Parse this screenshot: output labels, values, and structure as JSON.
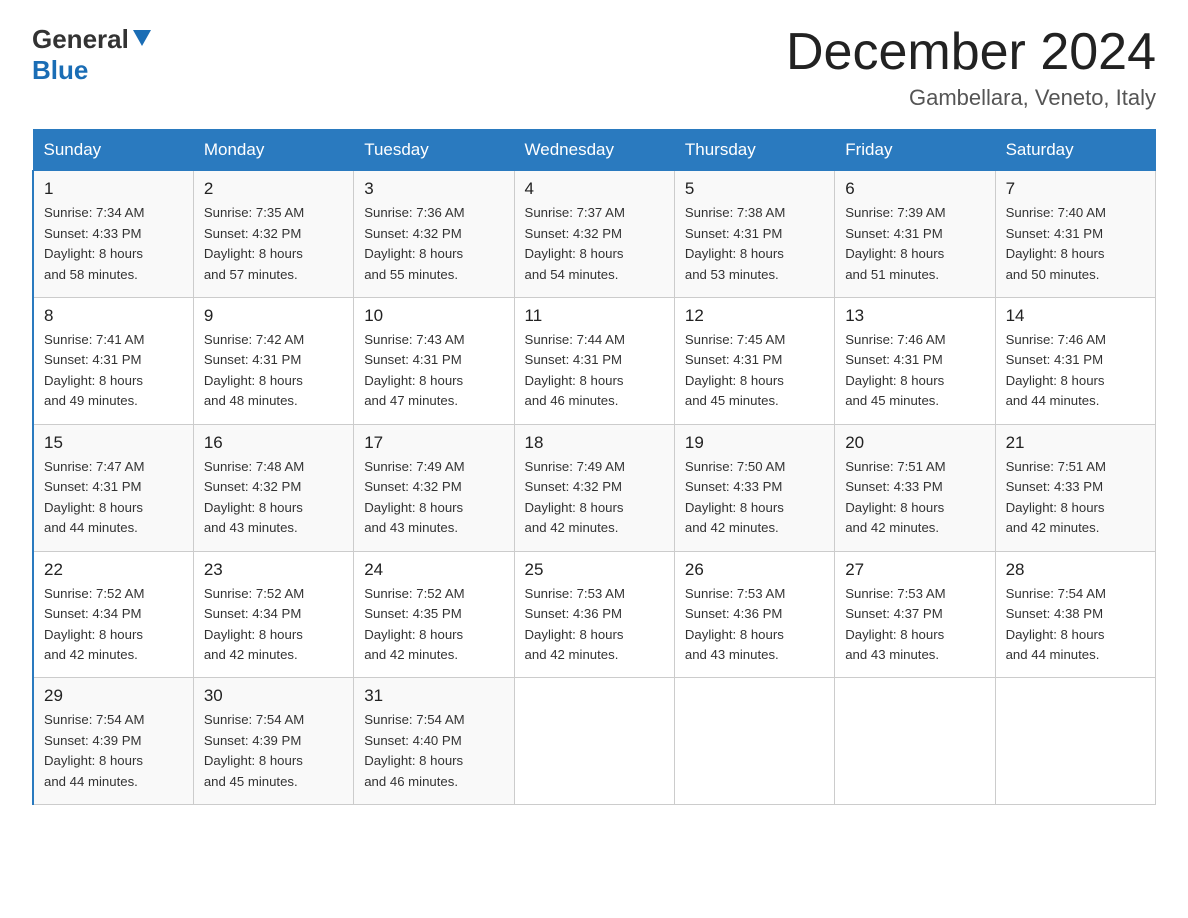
{
  "header": {
    "logo_general": "General",
    "logo_blue": "Blue",
    "month_title": "December 2024",
    "location": "Gambellara, Veneto, Italy"
  },
  "days_of_week": [
    "Sunday",
    "Monday",
    "Tuesday",
    "Wednesday",
    "Thursday",
    "Friday",
    "Saturday"
  ],
  "weeks": [
    [
      {
        "day": "1",
        "sunrise": "7:34 AM",
        "sunset": "4:33 PM",
        "daylight": "8 hours and 58 minutes."
      },
      {
        "day": "2",
        "sunrise": "7:35 AM",
        "sunset": "4:32 PM",
        "daylight": "8 hours and 57 minutes."
      },
      {
        "day": "3",
        "sunrise": "7:36 AM",
        "sunset": "4:32 PM",
        "daylight": "8 hours and 55 minutes."
      },
      {
        "day": "4",
        "sunrise": "7:37 AM",
        "sunset": "4:32 PM",
        "daylight": "8 hours and 54 minutes."
      },
      {
        "day": "5",
        "sunrise": "7:38 AM",
        "sunset": "4:31 PM",
        "daylight": "8 hours and 53 minutes."
      },
      {
        "day": "6",
        "sunrise": "7:39 AM",
        "sunset": "4:31 PM",
        "daylight": "8 hours and 51 minutes."
      },
      {
        "day": "7",
        "sunrise": "7:40 AM",
        "sunset": "4:31 PM",
        "daylight": "8 hours and 50 minutes."
      }
    ],
    [
      {
        "day": "8",
        "sunrise": "7:41 AM",
        "sunset": "4:31 PM",
        "daylight": "8 hours and 49 minutes."
      },
      {
        "day": "9",
        "sunrise": "7:42 AM",
        "sunset": "4:31 PM",
        "daylight": "8 hours and 48 minutes."
      },
      {
        "day": "10",
        "sunrise": "7:43 AM",
        "sunset": "4:31 PM",
        "daylight": "8 hours and 47 minutes."
      },
      {
        "day": "11",
        "sunrise": "7:44 AM",
        "sunset": "4:31 PM",
        "daylight": "8 hours and 46 minutes."
      },
      {
        "day": "12",
        "sunrise": "7:45 AM",
        "sunset": "4:31 PM",
        "daylight": "8 hours and 45 minutes."
      },
      {
        "day": "13",
        "sunrise": "7:46 AM",
        "sunset": "4:31 PM",
        "daylight": "8 hours and 45 minutes."
      },
      {
        "day": "14",
        "sunrise": "7:46 AM",
        "sunset": "4:31 PM",
        "daylight": "8 hours and 44 minutes."
      }
    ],
    [
      {
        "day": "15",
        "sunrise": "7:47 AM",
        "sunset": "4:31 PM",
        "daylight": "8 hours and 44 minutes."
      },
      {
        "day": "16",
        "sunrise": "7:48 AM",
        "sunset": "4:32 PM",
        "daylight": "8 hours and 43 minutes."
      },
      {
        "day": "17",
        "sunrise": "7:49 AM",
        "sunset": "4:32 PM",
        "daylight": "8 hours and 43 minutes."
      },
      {
        "day": "18",
        "sunrise": "7:49 AM",
        "sunset": "4:32 PM",
        "daylight": "8 hours and 42 minutes."
      },
      {
        "day": "19",
        "sunrise": "7:50 AM",
        "sunset": "4:33 PM",
        "daylight": "8 hours and 42 minutes."
      },
      {
        "day": "20",
        "sunrise": "7:51 AM",
        "sunset": "4:33 PM",
        "daylight": "8 hours and 42 minutes."
      },
      {
        "day": "21",
        "sunrise": "7:51 AM",
        "sunset": "4:33 PM",
        "daylight": "8 hours and 42 minutes."
      }
    ],
    [
      {
        "day": "22",
        "sunrise": "7:52 AM",
        "sunset": "4:34 PM",
        "daylight": "8 hours and 42 minutes."
      },
      {
        "day": "23",
        "sunrise": "7:52 AM",
        "sunset": "4:34 PM",
        "daylight": "8 hours and 42 minutes."
      },
      {
        "day": "24",
        "sunrise": "7:52 AM",
        "sunset": "4:35 PM",
        "daylight": "8 hours and 42 minutes."
      },
      {
        "day": "25",
        "sunrise": "7:53 AM",
        "sunset": "4:36 PM",
        "daylight": "8 hours and 42 minutes."
      },
      {
        "day": "26",
        "sunrise": "7:53 AM",
        "sunset": "4:36 PM",
        "daylight": "8 hours and 43 minutes."
      },
      {
        "day": "27",
        "sunrise": "7:53 AM",
        "sunset": "4:37 PM",
        "daylight": "8 hours and 43 minutes."
      },
      {
        "day": "28",
        "sunrise": "7:54 AM",
        "sunset": "4:38 PM",
        "daylight": "8 hours and 44 minutes."
      }
    ],
    [
      {
        "day": "29",
        "sunrise": "7:54 AM",
        "sunset": "4:39 PM",
        "daylight": "8 hours and 44 minutes."
      },
      {
        "day": "30",
        "sunrise": "7:54 AM",
        "sunset": "4:39 PM",
        "daylight": "8 hours and 45 minutes."
      },
      {
        "day": "31",
        "sunrise": "7:54 AM",
        "sunset": "4:40 PM",
        "daylight": "8 hours and 46 minutes."
      },
      null,
      null,
      null,
      null
    ]
  ],
  "labels": {
    "sunrise": "Sunrise:",
    "sunset": "Sunset:",
    "daylight": "Daylight:"
  }
}
